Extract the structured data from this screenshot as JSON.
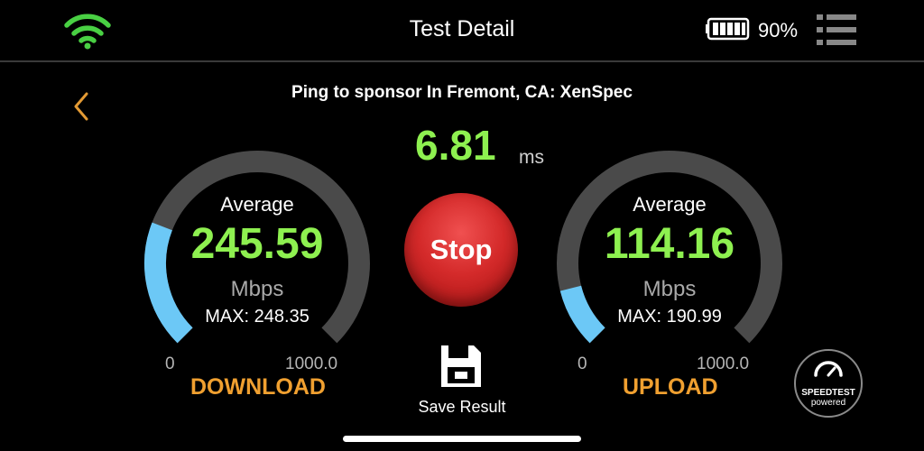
{
  "header": {
    "title": "Test Detail",
    "battery_percent": "90%",
    "icons": [
      "wifi-icon",
      "battery-icon",
      "menu-icon",
      "back-chevron-icon"
    ]
  },
  "ping": {
    "label": "Ping to sponsor In Fremont, CA: XenSpec",
    "value": "6.81",
    "unit": "ms"
  },
  "download": {
    "title": "DOWNLOAD",
    "avg_label": "Average",
    "value": "245.59",
    "unit": "Mbps",
    "max": "MAX: 248.35",
    "min_tick": "0",
    "max_tick": "1000.0",
    "fill_fraction": 0.2456
  },
  "upload": {
    "title": "UPLOAD",
    "avg_label": "Average",
    "value": "114.16",
    "unit": "Mbps",
    "max": "MAX: 190.99",
    "min_tick": "0",
    "max_tick": "1000.0",
    "fill_fraction": 0.1142
  },
  "controls": {
    "stop_label": "Stop",
    "save_label": "Save Result"
  },
  "badge": {
    "line1": "SPEEDTEST",
    "line2": "powered"
  },
  "colors": {
    "accent_green": "#8ef050",
    "gauge_fill": "#6cc8f6",
    "gauge_track": "#4a4a4a",
    "label_orange": "#f0a030",
    "stop_red": "#d42a2a",
    "back_orange": "#e39a34"
  }
}
